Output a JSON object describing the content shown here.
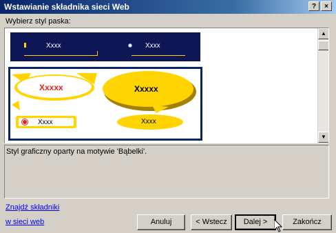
{
  "window": {
    "title": "Wstawianie składnika sieci Web",
    "help_label": "?",
    "close_label": "×"
  },
  "style_section": {
    "label": "Wybierz styl paska:",
    "preview_dark": {
      "item1": "Xxxx",
      "item2": "Xxxx"
    },
    "preview_bubbles": {
      "bubble_left": "Xxxxx",
      "bubble_right": "Xxxxx",
      "small_left": "Xxxx",
      "small_right": "Xxxx"
    },
    "colors": {
      "selection": "#0a246a",
      "dark_strip": "#0f1655",
      "bubble_yellow": "#ffd400",
      "bubble_text_red": "#e8211f"
    }
  },
  "description": "Styl graficzny oparty na motywie 'Bąbelki'.",
  "link": {
    "line1": "Znajdź składniki",
    "line2": "w sieci web"
  },
  "buttons": {
    "cancel": "Anuluj",
    "back": "< Wstecz",
    "next": "Dalej >",
    "finish": "Zakończ"
  },
  "icons": {
    "scroll_up": "scroll-up-arrow-icon",
    "scroll_down": "scroll-down-arrow-icon",
    "cursor": "mouse-pointer-icon"
  }
}
